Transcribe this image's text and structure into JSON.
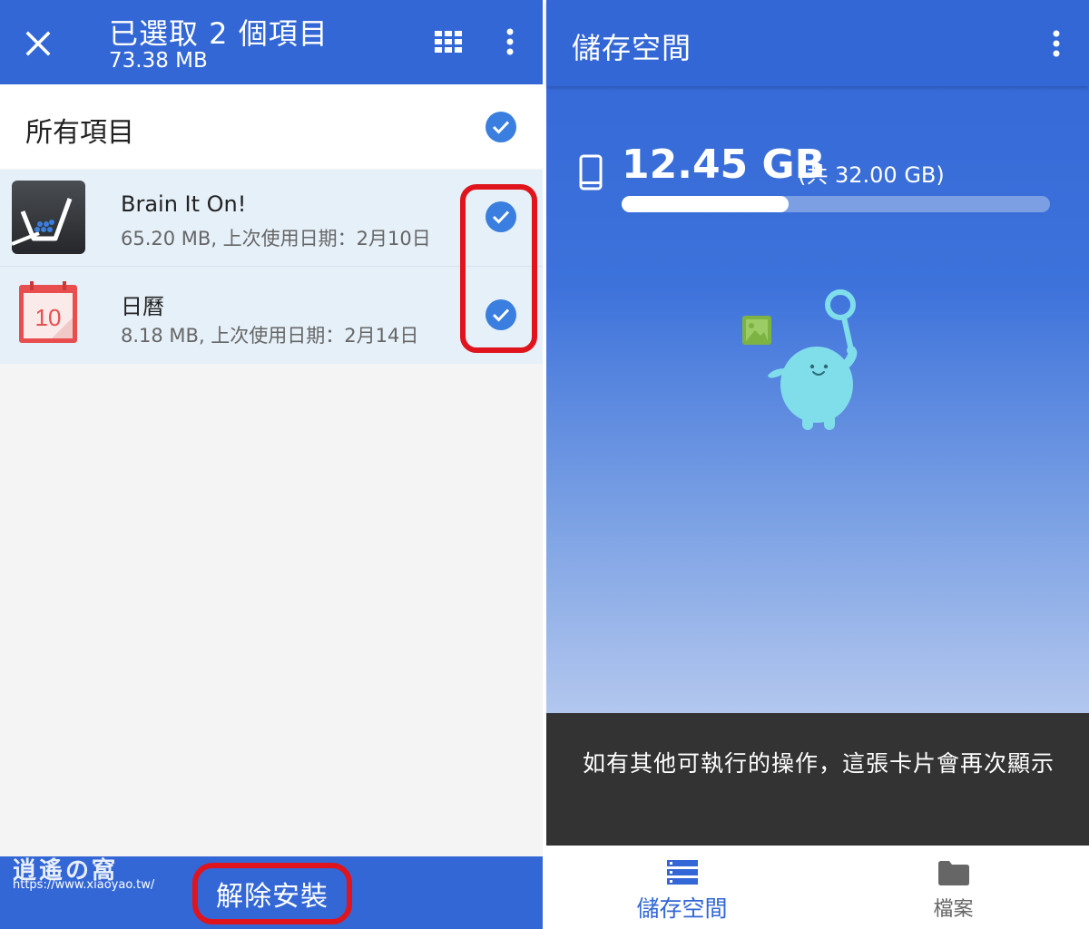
{
  "left": {
    "header": {
      "title": "已選取 2 個項目",
      "subtitle": "73.38 MB",
      "icons": [
        "close-icon",
        "grid-view-icon",
        "more-vert-icon"
      ]
    },
    "all_items_label": "所有項目",
    "apps": [
      {
        "name": "Brain It On!",
        "meta": "65.20 MB, 上次使用日期：2月10日",
        "selected": true,
        "icon": "brain-it-on-app-icon"
      },
      {
        "name": "日曆",
        "meta": "8.18 MB, 上次使用日期：2月14日",
        "selected": true,
        "icon": "calendar-app-icon",
        "icon_text": "10"
      }
    ],
    "bottom": {
      "uninstall_label": "解除安裝",
      "watermark_title": "逍遙の窩",
      "watermark_url": "https://www.xiaoyao.tw/"
    }
  },
  "right": {
    "header": {
      "title": "儲存空間",
      "icons": [
        "more-vert-icon"
      ]
    },
    "storage": {
      "used": "12.45 GB",
      "total": "(共 32.00 GB)",
      "used_fraction": 0.389
    },
    "snackbar_text": "如有其他可執行的操作，這張卡片會再次顯示",
    "nav": [
      {
        "label": "儲存空間",
        "icon": "storage-icon",
        "active": true
      },
      {
        "label": "檔案",
        "icon": "folder-icon",
        "active": false
      }
    ]
  },
  "colors": {
    "primary": "#3367d6",
    "check": "#3a7ee0",
    "highlight_red": "#e0141c",
    "selected_row": "#e6f0f8",
    "snackbar": "#333333"
  }
}
